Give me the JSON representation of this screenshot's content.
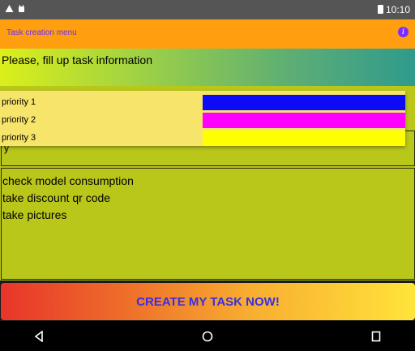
{
  "status_bar": {
    "time": "10:10",
    "icons": [
      "signal-triangle-icon",
      "android-icon",
      "battery-icon"
    ]
  },
  "toolbar": {
    "title": "Task creation menu",
    "info_icon": "i",
    "color": "#ff9f0f"
  },
  "header": {
    "prompt": "Please, fill up task information"
  },
  "priority_dropdown": {
    "options": [
      {
        "label": "priority 1",
        "color": "#0b0bf5"
      },
      {
        "label": "priority 2",
        "color": "#ff00ff"
      },
      {
        "label": "priority 3",
        "color": "#ffff00"
      }
    ],
    "field_peek_text": "y"
  },
  "description": {
    "lines": [
      "check model consumption",
      "take discount qr code",
      "take pictures"
    ]
  },
  "create_button": {
    "label": "CREATE MY TASK NOW!"
  },
  "nav_bar": {
    "buttons": [
      "back-icon",
      "home-icon",
      "recents-icon"
    ]
  }
}
